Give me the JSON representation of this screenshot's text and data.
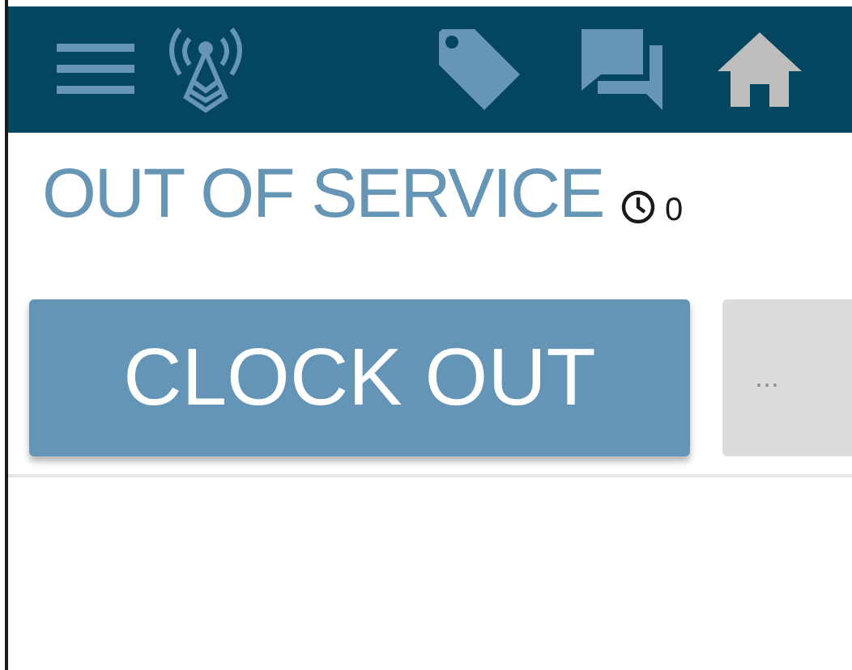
{
  "status": {
    "label": "OUT OF SERVICE",
    "timer_count": "0"
  },
  "buttons": [
    {
      "label": "CLOCK OUT",
      "kind": "primary"
    },
    {
      "label": "...",
      "kind": "secondary"
    }
  ]
}
